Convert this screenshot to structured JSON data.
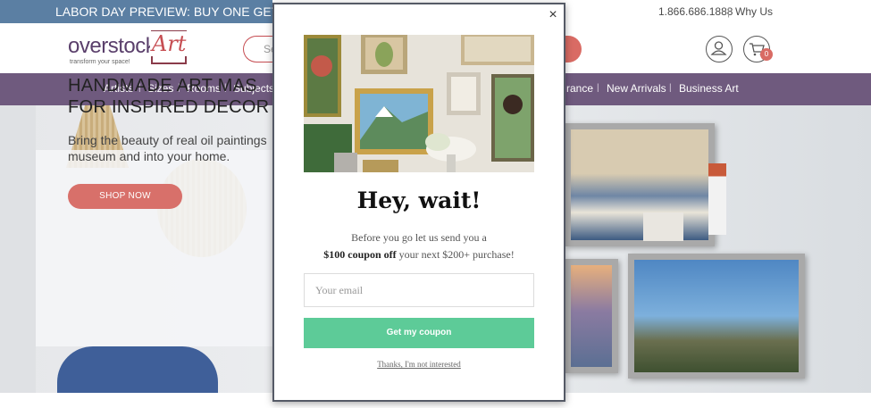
{
  "promo": {
    "banner_text": "LABOR DAY PREVIEW: BUY ONE GET ONE",
    "phone": "1.866.686.1888",
    "separator": "|",
    "why_us": "Why Us"
  },
  "header": {
    "logo_word": "overstock",
    "logo_art": "Art",
    "logo_tagline": "transform your space!",
    "search_placeholder": "Se",
    "cart_count": "0"
  },
  "nav": {
    "items": [
      "Artists",
      "Sizes",
      "Rooms",
      "Subjects",
      "rance",
      "New Arrivals",
      "Business Art"
    ],
    "separator": "|"
  },
  "hero": {
    "title": "HANDMADE ART MAS\nFOR INSPIRED DECOR",
    "subtitle": "Bring the beauty of real oil paintings\nmuseum and into your home.",
    "cta_label": "SHOP NOW"
  },
  "modal": {
    "close_glyph": "×",
    "title": "Hey, wait!",
    "line1": "Before you go let us send you a",
    "line2_bold": "$100 coupon off",
    "line2_rest": " your next $200+ purchase!",
    "email_placeholder": "Your email",
    "submit_label": "Get my coupon",
    "decline_label": "Thanks, I'm not interested"
  },
  "colors": {
    "promo_blue": "#5b7fa3",
    "nav_purple": "#6f5a7e",
    "brand_coral": "#d8706a",
    "coupon_green": "#5dcb98"
  },
  "icons": {
    "account": "user-icon",
    "cart": "cart-icon",
    "close": "close-icon"
  }
}
